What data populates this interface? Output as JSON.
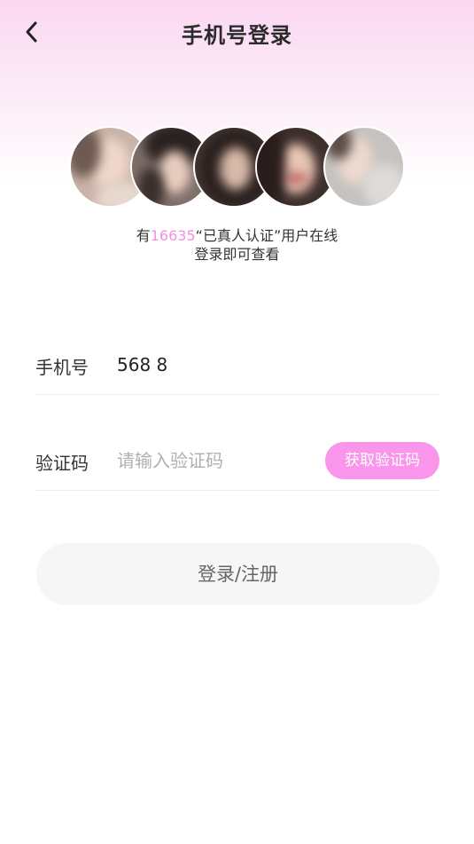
{
  "header": {
    "title": "手机号登录",
    "back_icon": "chevron-left-icon"
  },
  "online": {
    "prefix": "有",
    "count": "16635",
    "suffix": "“已真人认证”用户在线",
    "line2": "登录即可查看",
    "count_color": "#f38ee4"
  },
  "form": {
    "phone": {
      "label": "手机号",
      "value": "568 8"
    },
    "code": {
      "label": "验证码",
      "placeholder": "请输入验证码",
      "button_label": "获取验证码"
    }
  },
  "login_button": {
    "label": "登录/注册"
  },
  "colors": {
    "accent": "#f995ea",
    "gradient_top": "#fbd7f1"
  }
}
